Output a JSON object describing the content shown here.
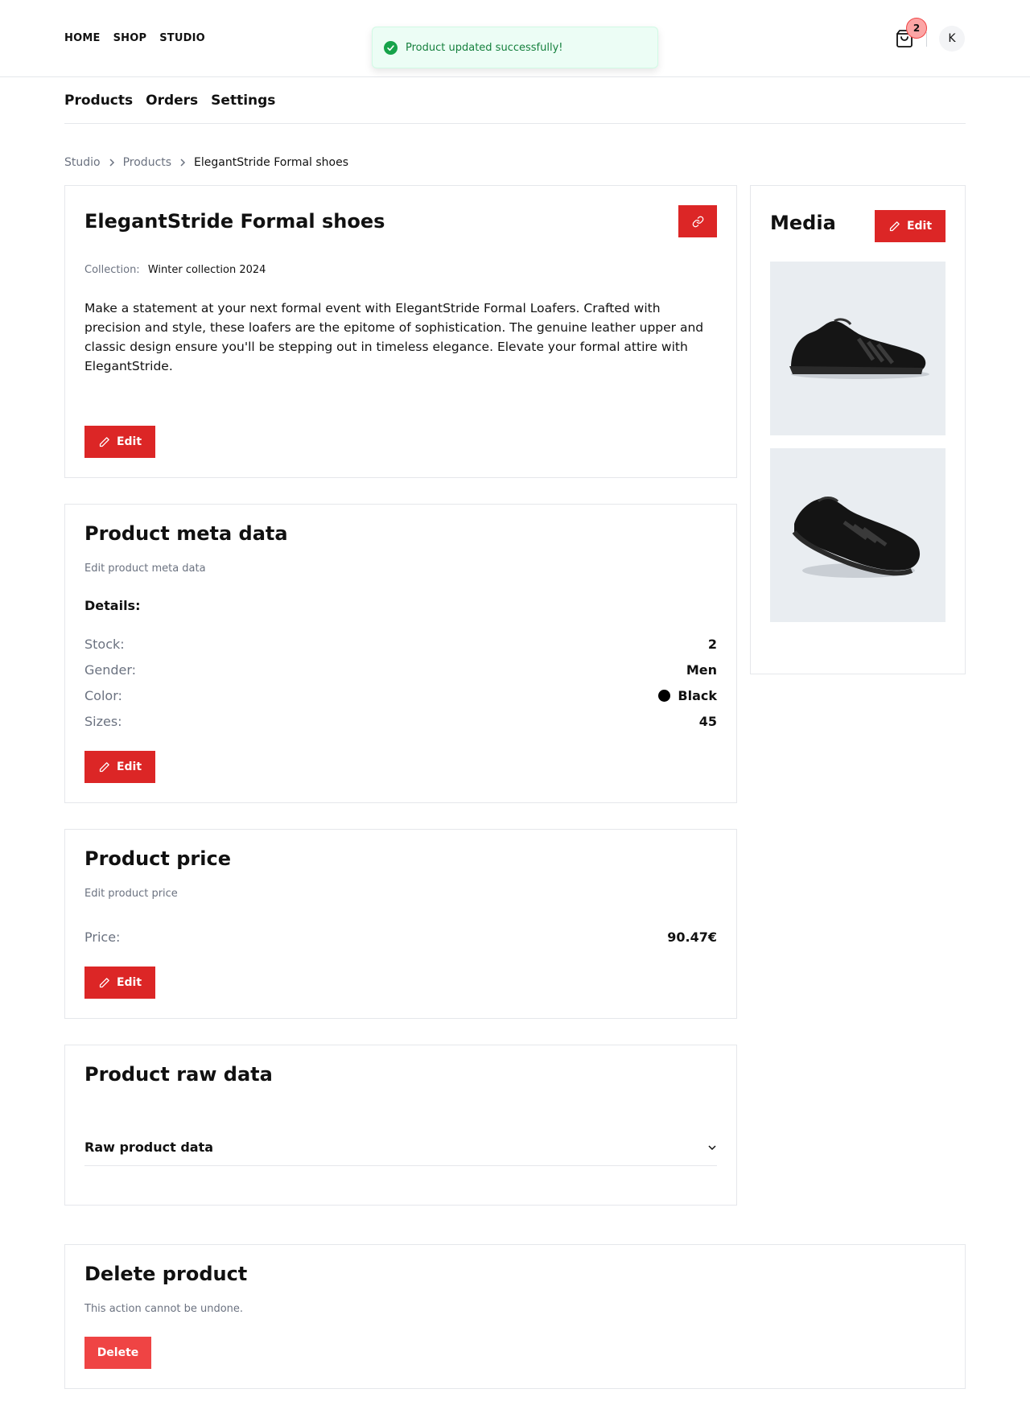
{
  "topnav": {
    "home": "HOME",
    "shop": "SHOP",
    "studio": "STUDIO"
  },
  "cart": {
    "count": "2",
    "icon": "shopping-bag-icon"
  },
  "avatar": {
    "initial": "K"
  },
  "toast": {
    "message": "Product updated successfully!",
    "icon": "check-circle-icon"
  },
  "subnav": {
    "products": "Products",
    "orders": "Orders",
    "settings": "Settings"
  },
  "breadcrumb": {
    "items": [
      "Studio",
      "Products",
      "ElegantStride Formal shoes"
    ]
  },
  "product": {
    "title": "ElegantStride Formal shoes",
    "collection_label": "Collection:",
    "collection": "Winter collection 2024",
    "description": "Make a statement at your next formal event with ElegantStride Formal Loafers. Crafted with precision and style, these loafers are the epitome of sophistication. The genuine leather upper and classic design ensure you'll be stepping out in timeless elegance. Elevate your formal attire with ElegantStride.",
    "edit_label": "Edit",
    "link_icon": "link-icon"
  },
  "meta": {
    "title": "Product meta data",
    "subtitle": "Edit product meta data",
    "details_heading": "Details:",
    "rows": [
      {
        "label": "Stock:",
        "value": "2"
      },
      {
        "label": "Gender:",
        "value": "Men"
      },
      {
        "label": "Color:",
        "value": "Black",
        "swatch": "#000000"
      },
      {
        "label": "Sizes:",
        "value": "45"
      }
    ],
    "edit_label": "Edit"
  },
  "price": {
    "title": "Product price",
    "subtitle": "Edit product price",
    "label": "Price:",
    "value": "90.47€",
    "edit_label": "Edit"
  },
  "raw": {
    "title": "Product raw data",
    "accordion_label": "Raw product data",
    "icon": "chevron-down-icon"
  },
  "media": {
    "title": "Media",
    "edit_label": "Edit",
    "images": [
      "shoe-side-view",
      "shoe-angle-view"
    ]
  },
  "delete": {
    "title": "Delete product",
    "subtitle": "This action cannot be undone.",
    "button_label": "Delete"
  },
  "colors": {
    "accent": "#dc2626",
    "delete": "#ef4444",
    "success_bg": "#ecfdf5",
    "success_text": "#15803d"
  }
}
